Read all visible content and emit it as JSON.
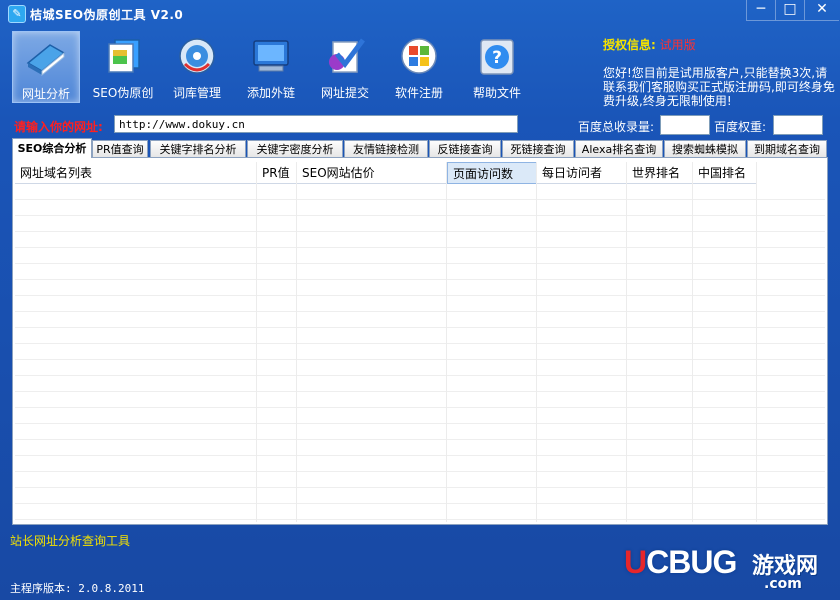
{
  "window": {
    "title": "桔城SEO伪原创工具 V2.0",
    "controls": {
      "minimize": "─",
      "maximize": "□",
      "close": "✕"
    }
  },
  "toolbar": {
    "items": [
      {
        "label": "网址分析",
        "icon": "book-icon"
      },
      {
        "label": "SEO伪原创",
        "icon": "documents-icon"
      },
      {
        "label": "词库管理",
        "icon": "disc-icon"
      },
      {
        "label": "添加外链",
        "icon": "monitor-icon"
      },
      {
        "label": "网址提交",
        "icon": "check-icon"
      },
      {
        "label": "软件注册",
        "icon": "windows-icon"
      },
      {
        "label": "帮助文件",
        "icon": "help-icon"
      }
    ]
  },
  "license": {
    "label": "授权信息:",
    "value": "试用版",
    "message": "您好!您目前是试用版客户,只能替换3次,请联系我们客服购买正式版注册码,即可终身免费升级,终身无限制使用!"
  },
  "url_row": {
    "label": "请输入你的网址:",
    "value": "http://www.dokuy.cn",
    "baidu_total_label": "百度总收录量:",
    "baidu_total_value": "",
    "baidu_weight_label": "百度权重:",
    "baidu_weight_value": ""
  },
  "tabs": [
    "SEO综合分析",
    "PR值查询",
    "关键字排名分析",
    "关键字密度分析",
    "友情链接检测",
    "反链接查询",
    "死链接查询",
    "Alexa排名查询",
    "搜索蜘蛛模拟",
    "到期域名查询"
  ],
  "active_tab": "SEO综合分析",
  "grid": {
    "columns": [
      "网址域名列表",
      "PR值",
      "SEO网站估价",
      "页面访问数",
      "每日访问者",
      "世界排名",
      "中国排名"
    ],
    "selected_column": "页面访问数",
    "rows": []
  },
  "footer": {
    "tool_name": "站长网址分析查询工具",
    "version": "主程序版本: 2.0.8.2011"
  },
  "watermark": {
    "logo": "UCBUG",
    "cn": "游戏网",
    "domain": ".com"
  },
  "colors": {
    "window_bg": "#1a55b8",
    "accent_yellow": "#f4e200",
    "alert_red": "#ff2020"
  }
}
